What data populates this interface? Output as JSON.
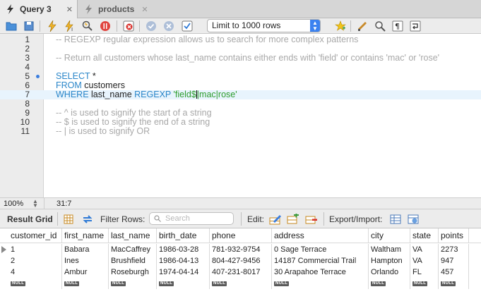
{
  "tabs": [
    {
      "label": "Query 3",
      "close": "✕"
    },
    {
      "label": "products",
      "close": "✕"
    }
  ],
  "toolbar": {
    "limit_label": "Limit to 1000 rows",
    "icons": [
      "open-folder-icon",
      "save-icon",
      "execute-icon",
      "execute-current-icon",
      "explain-icon",
      "stop-icon",
      "toggle-error-icon",
      "commit-icon",
      "rollback-icon",
      "autocommit-icon",
      "beautify-icon",
      "snippet-icon",
      "find-icon",
      "invisibles-icon",
      "wrap-icon"
    ]
  },
  "editor": {
    "lines": [
      {
        "num": "1",
        "parts": [
          {
            "t": "-- REGEXP regular expression allows us to search for more complex patterns",
            "c": "cmt"
          }
        ]
      },
      {
        "num": "2",
        "parts": []
      },
      {
        "num": "3",
        "parts": [
          {
            "t": "-- Return all customers whose last_name contains either ends with 'field' or contains 'mac' or 'rose'",
            "c": "cmt"
          }
        ]
      },
      {
        "num": "4",
        "parts": []
      },
      {
        "num": "5",
        "parts": [
          {
            "t": "SELECT",
            "c": "kw"
          },
          {
            "t": " *",
            "c": ""
          }
        ]
      },
      {
        "num": "6",
        "parts": [
          {
            "t": "FROM",
            "c": "kw"
          },
          {
            "t": " customers",
            "c": ""
          }
        ]
      },
      {
        "num": "7",
        "parts": [
          {
            "t": "WHERE",
            "c": "kw"
          },
          {
            "t": " last_name ",
            "c": ""
          },
          {
            "t": "REGEXP",
            "c": "kw"
          },
          {
            "t": " ",
            "c": ""
          },
          {
            "t": "'field$",
            "c": "str"
          },
          {
            "t": "|mac|rose'",
            "c": "str"
          }
        ]
      },
      {
        "num": "8",
        "parts": []
      },
      {
        "num": "9",
        "parts": [
          {
            "t": "-- ^ is used to signify the start of a string",
            "c": "cmt"
          }
        ]
      },
      {
        "num": "10",
        "parts": [
          {
            "t": "-- $ is used to signify the end of a string",
            "c": "cmt"
          }
        ]
      },
      {
        "num": "11",
        "parts": [
          {
            "t": "-- | is used to signify OR",
            "c": "cmt"
          }
        ]
      }
    ],
    "zoom": "100%",
    "cursor_pos": "31:7"
  },
  "result_toolbar": {
    "result_grid_label": "Result Grid",
    "filter_label": "Filter Rows:",
    "search_placeholder": "Search",
    "edit_label": "Edit:",
    "export_label": "Export/Import:"
  },
  "grid": {
    "columns": [
      "customer_id",
      "first_name",
      "last_name",
      "birth_date",
      "phone",
      "address",
      "city",
      "state",
      "points"
    ],
    "rows": [
      [
        "1",
        "Babara",
        "MacCaffrey",
        "1986-03-28",
        "781-932-9754",
        "0 Sage Terrace",
        "Waltham",
        "VA",
        "2273"
      ],
      [
        "2",
        "Ines",
        "Brushfield",
        "1986-04-13",
        "804-427-9456",
        "14187 Commercial Trail",
        "Hampton",
        "VA",
        "947"
      ],
      [
        "4",
        "Ambur",
        "Roseburgh",
        "1974-04-14",
        "407-231-8017",
        "30 Arapahoe Terrace",
        "Orlando",
        "FL",
        "457"
      ]
    ],
    "null_label": "NULL"
  }
}
